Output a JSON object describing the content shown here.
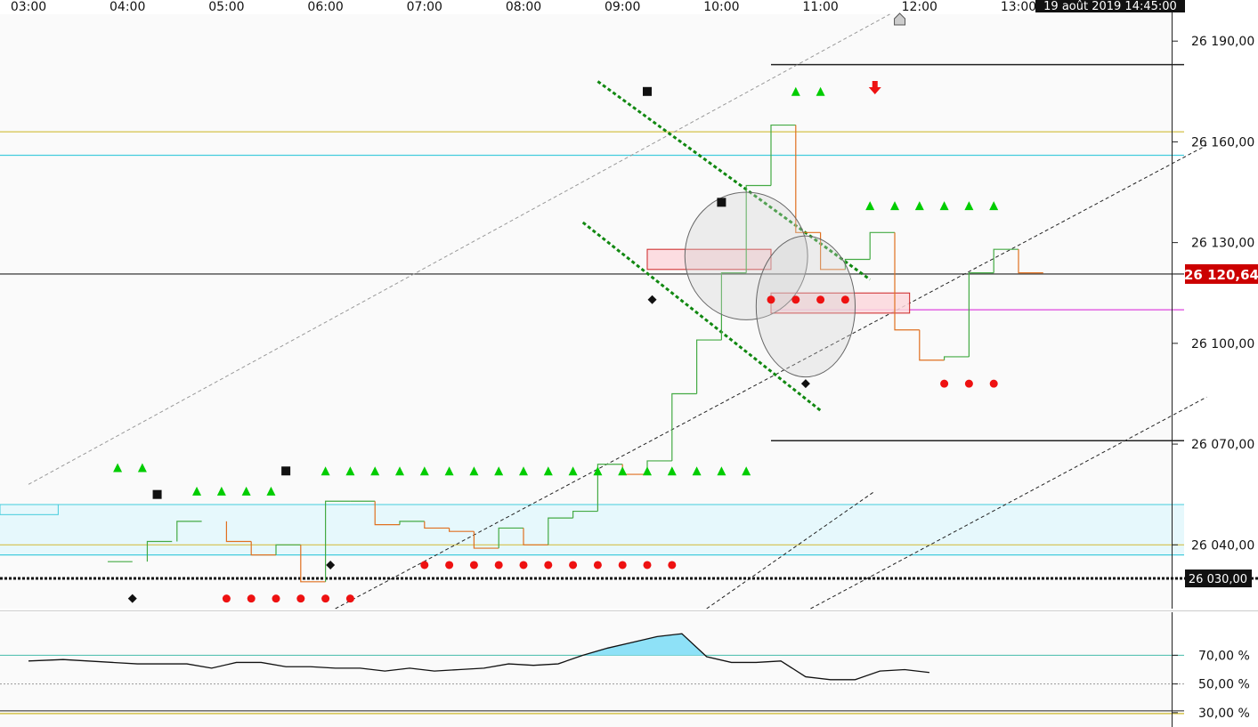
{
  "chart_data": [
    {
      "type": "line",
      "subtype": "step-candles",
      "x_labels": [
        "03:00",
        "04:00",
        "05:00",
        "06:00",
        "07:00",
        "08:00",
        "09:00",
        "10:00",
        "11:00",
        "12:00",
        "13:00"
      ],
      "current_datetime": "19 août 2019 14:45:00",
      "y_ticks": [
        "26 190,00",
        "26 160,00",
        "26 130,00",
        "26 100,00",
        "26 070,00",
        "26 040,00"
      ],
      "ylim": [
        26021,
        26198
      ],
      "last_price": 26120.64,
      "last_price_label": "26 120,64",
      "dotted_level": 26030,
      "dotted_level_label": "26 030,00",
      "grid": false,
      "colors": {
        "up": "#44aa44",
        "down": "#e07020",
        "signal_up": "#00cc00",
        "signal_down": "#ee1111",
        "price_badge": "#cc0000",
        "level_yellow": "#d4c24a",
        "level_cyan": "#44ccdd",
        "level_magenta": "#dd44dd",
        "zone_fill": "#e6f8fc",
        "box_fill": "#fbd7dc",
        "box_stroke": "#cc2222"
      },
      "candles": [
        {
          "t": 0.8,
          "o": 26035,
          "c": 26035
        },
        {
          "t": 1.2,
          "o": 26035,
          "c": 26041
        },
        {
          "t": 1.5,
          "o": 26041,
          "c": 26047
        },
        {
          "t": 2.0,
          "o": 26047,
          "c": 26041
        },
        {
          "t": 2.25,
          "o": 26041,
          "c": 26037
        },
        {
          "t": 2.5,
          "o": 26037,
          "c": 26040
        },
        {
          "t": 2.75,
          "o": 26040,
          "c": 26029
        },
        {
          "t": 3.0,
          "o": 26029,
          "c": 26053
        },
        {
          "t": 3.25,
          "o": 26053,
          "c": 26053
        },
        {
          "t": 3.5,
          "o": 26053,
          "c": 26046
        },
        {
          "t": 3.75,
          "o": 26046,
          "c": 26047
        },
        {
          "t": 4.0,
          "o": 26047,
          "c": 26045
        },
        {
          "t": 4.25,
          "o": 26045,
          "c": 26044
        },
        {
          "t": 4.5,
          "o": 26044,
          "c": 26039
        },
        {
          "t": 4.75,
          "o": 26039,
          "c": 26045
        },
        {
          "t": 5.0,
          "o": 26045,
          "c": 26040
        },
        {
          "t": 5.25,
          "o": 26040,
          "c": 26048
        },
        {
          "t": 5.5,
          "o": 26048,
          "c": 26050
        },
        {
          "t": 5.75,
          "o": 26050,
          "c": 26064
        },
        {
          "t": 6.0,
          "o": 26064,
          "c": 26061
        },
        {
          "t": 6.25,
          "o": 26061,
          "c": 26065
        },
        {
          "t": 6.5,
          "o": 26065,
          "c": 26085
        },
        {
          "t": 6.75,
          "o": 26085,
          "c": 26101
        },
        {
          "t": 7.0,
          "o": 26101,
          "c": 26121
        },
        {
          "t": 7.25,
          "o": 26121,
          "c": 26147
        },
        {
          "t": 7.5,
          "o": 26147,
          "c": 26165
        },
        {
          "t": 7.75,
          "o": 26165,
          "c": 26133
        },
        {
          "t": 8.0,
          "o": 26133,
          "c": 26122
        },
        {
          "t": 8.25,
          "o": 26122,
          "c": 26125
        },
        {
          "t": 8.5,
          "o": 26125,
          "c": 26133
        },
        {
          "t": 8.75,
          "o": 26133,
          "c": 26104
        },
        {
          "t": 9.0,
          "o": 26104,
          "c": 26095
        },
        {
          "t": 9.25,
          "o": 26095,
          "c": 26096
        },
        {
          "t": 9.5,
          "o": 26096,
          "c": 26121
        },
        {
          "t": 9.75,
          "o": 26121,
          "c": 26128
        },
        {
          "t": 10.0,
          "o": 26128,
          "c": 26121
        }
      ],
      "signals_up_triangles": [
        {
          "t": 0.9,
          "y": 26063
        },
        {
          "t": 1.15,
          "y": 26063
        },
        {
          "t": 1.7,
          "y": 26056
        },
        {
          "t": 1.95,
          "y": 26056
        },
        {
          "t": 2.2,
          "y": 26056
        },
        {
          "t": 2.45,
          "y": 26056
        },
        {
          "t": 3.0,
          "y": 26062
        },
        {
          "t": 3.25,
          "y": 26062
        },
        {
          "t": 3.5,
          "y": 26062
        },
        {
          "t": 3.75,
          "y": 26062
        },
        {
          "t": 4.0,
          "y": 26062
        },
        {
          "t": 4.25,
          "y": 26062
        },
        {
          "t": 4.5,
          "y": 26062
        },
        {
          "t": 4.75,
          "y": 26062
        },
        {
          "t": 5.0,
          "y": 26062
        },
        {
          "t": 5.25,
          "y": 26062
        },
        {
          "t": 5.5,
          "y": 26062
        },
        {
          "t": 5.75,
          "y": 26062
        },
        {
          "t": 6.0,
          "y": 26062
        },
        {
          "t": 6.25,
          "y": 26062
        },
        {
          "t": 6.5,
          "y": 26062
        },
        {
          "t": 6.75,
          "y": 26062
        },
        {
          "t": 7.0,
          "y": 26062
        },
        {
          "t": 7.25,
          "y": 26062
        },
        {
          "t": 7.75,
          "y": 26175
        },
        {
          "t": 8.0,
          "y": 26175
        },
        {
          "t": 8.5,
          "y": 26141
        },
        {
          "t": 8.75,
          "y": 26141
        },
        {
          "t": 9.0,
          "y": 26141
        },
        {
          "t": 9.25,
          "y": 26141
        },
        {
          "t": 9.5,
          "y": 26141
        },
        {
          "t": 9.75,
          "y": 26141
        }
      ],
      "signals_down_dots": [
        {
          "t": 2.0,
          "y": 26024
        },
        {
          "t": 2.25,
          "y": 26024
        },
        {
          "t": 2.5,
          "y": 26024
        },
        {
          "t": 2.75,
          "y": 26024
        },
        {
          "t": 3.0,
          "y": 26024
        },
        {
          "t": 3.25,
          "y": 26024
        },
        {
          "t": 4.0,
          "y": 26034
        },
        {
          "t": 4.25,
          "y": 26034
        },
        {
          "t": 4.5,
          "y": 26034
        },
        {
          "t": 4.75,
          "y": 26034
        },
        {
          "t": 5.0,
          "y": 26034
        },
        {
          "t": 5.25,
          "y": 26034
        },
        {
          "t": 5.5,
          "y": 26034
        },
        {
          "t": 5.75,
          "y": 26034
        },
        {
          "t": 6.0,
          "y": 26034
        },
        {
          "t": 6.25,
          "y": 26034
        },
        {
          "t": 6.5,
          "y": 26034
        },
        {
          "t": 7.5,
          "y": 26113
        },
        {
          "t": 7.75,
          "y": 26113
        },
        {
          "t": 8.0,
          "y": 26113
        },
        {
          "t": 8.25,
          "y": 26113
        },
        {
          "t": 9.25,
          "y": 26088
        },
        {
          "t": 9.5,
          "y": 26088
        },
        {
          "t": 9.75,
          "y": 26088
        }
      ],
      "black_squares": [
        {
          "t": 1.3,
          "y": 26055
        },
        {
          "t": 2.6,
          "y": 26062
        },
        {
          "t": 6.25,
          "y": 26175
        },
        {
          "t": 7.0,
          "y": 26142
        }
      ],
      "black_diamonds": [
        {
          "t": 1.05,
          "y": 26024
        },
        {
          "t": 3.05,
          "y": 26034
        },
        {
          "t": 6.3,
          "y": 26113
        },
        {
          "t": 7.85,
          "y": 26088
        }
      ],
      "horizontal_levels": [
        {
          "y": 26183,
          "color": "#222222",
          "from": 7.5
        },
        {
          "y": 26163,
          "color": "#d4c24a"
        },
        {
          "y": 26156,
          "color": "#44ccdd"
        },
        {
          "y": 26120.64,
          "color": "#222222"
        },
        {
          "y": 26110,
          "color": "#dd44dd",
          "from": 7.5
        },
        {
          "y": 26071,
          "color": "#222222",
          "from": 7.5
        },
        {
          "y": 26040,
          "color": "#d4c24a"
        },
        {
          "y": 26037,
          "color": "#44ccdd"
        }
      ],
      "zone": {
        "y_top": 26052,
        "y_bottom": 26037
      },
      "zone_label_box": {
        "t0": 0.0,
        "t1": 0.3,
        "y_top": 26052,
        "y_bottom": 26049
      },
      "boxes": [
        {
          "t0": 6.25,
          "t1": 7.5,
          "y_top": 26128,
          "y_bottom": 26122
        },
        {
          "t0": 7.5,
          "t1": 8.9,
          "y_top": 26115,
          "y_bottom": 26109
        }
      ],
      "ellipses": [
        {
          "t": 7.25,
          "y": 26126,
          "rt": 0.62,
          "ry": 19
        },
        {
          "t": 7.85,
          "y": 26111,
          "rt": 0.5,
          "ry": 21
        }
      ],
      "trend_green": [
        {
          "t0": 5.75,
          "y0": 26178,
          "t1": 8.5,
          "y1": 26119
        },
        {
          "t0": 5.6,
          "y0": 26136,
          "t1": 8.0,
          "y1": 26080
        }
      ],
      "trend_dashed": [
        {
          "t0": 0.0,
          "y0": 26058,
          "t1": 8.7,
          "y1": 26198,
          "color": "#999999"
        },
        {
          "t0": 3.1,
          "y0": 26021,
          "t1": 11.9,
          "y1": 26159,
          "color": "#222222"
        },
        {
          "t0": 6.85,
          "y0": 26021,
          "t1": 8.55,
          "y1": 26056,
          "color": "#222222"
        },
        {
          "t0": 7.9,
          "y0": 26021,
          "t1": 11.9,
          "y1": 26084,
          "color": "#222222"
        }
      ],
      "arrow_down": {
        "t": 8.55,
        "y": 26176
      },
      "marker_top": {
        "t": 8.8
      }
    },
    {
      "type": "line",
      "indicator": "oscillator",
      "y_ticks": [
        "70,00 %",
        "50,00 %",
        "30,00 %"
      ],
      "ylim": [
        20,
        100
      ],
      "levels": [
        {
          "y": 70,
          "color": "#44bbaa",
          "style": "solid"
        },
        {
          "y": 50,
          "color": "#999999",
          "style": "dotted"
        },
        {
          "y": 30,
          "color": "#d4c24a",
          "style": "double"
        }
      ],
      "overbought_fill": "#8ee1f7",
      "series": [
        {
          "values": [
            {
              "t": 0.0,
              "y": 66
            },
            {
              "t": 0.35,
              "y": 67
            },
            {
              "t": 0.85,
              "y": 65
            },
            {
              "t": 1.1,
              "y": 64
            },
            {
              "t": 1.6,
              "y": 64
            },
            {
              "t": 1.85,
              "y": 61
            },
            {
              "t": 2.1,
              "y": 65
            },
            {
              "t": 2.35,
              "y": 65
            },
            {
              "t": 2.6,
              "y": 62
            },
            {
              "t": 2.85,
              "y": 62
            },
            {
              "t": 3.1,
              "y": 61
            },
            {
              "t": 3.35,
              "y": 61
            },
            {
              "t": 3.6,
              "y": 59
            },
            {
              "t": 3.85,
              "y": 61
            },
            {
              "t": 4.1,
              "y": 59
            },
            {
              "t": 4.35,
              "y": 60
            },
            {
              "t": 4.6,
              "y": 61
            },
            {
              "t": 4.85,
              "y": 64
            },
            {
              "t": 5.1,
              "y": 63
            },
            {
              "t": 5.35,
              "y": 64
            },
            {
              "t": 5.6,
              "y": 70
            },
            {
              "t": 5.85,
              "y": 75
            },
            {
              "t": 6.1,
              "y": 79
            },
            {
              "t": 6.35,
              "y": 83
            },
            {
              "t": 6.6,
              "y": 85
            },
            {
              "t": 6.85,
              "y": 69
            },
            {
              "t": 7.1,
              "y": 65
            },
            {
              "t": 7.35,
              "y": 65
            },
            {
              "t": 7.6,
              "y": 66
            },
            {
              "t": 7.85,
              "y": 55
            },
            {
              "t": 8.1,
              "y": 53
            },
            {
              "t": 8.35,
              "y": 53
            },
            {
              "t": 8.6,
              "y": 59
            },
            {
              "t": 8.85,
              "y": 60
            },
            {
              "t": 9.1,
              "y": 58
            }
          ]
        }
      ]
    }
  ]
}
